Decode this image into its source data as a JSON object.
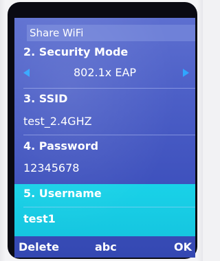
{
  "header": {
    "title": "Share WiFi"
  },
  "fields": [
    {
      "label": "2. Security Mode",
      "value": "802.1x EAP"
    },
    {
      "label": "3. SSID",
      "value": "test_2.4GHZ"
    },
    {
      "label": "4. Password",
      "value": "12345678"
    },
    {
      "label": "5. Username",
      "value": "test1"
    }
  ],
  "softkeys": {
    "left": "Delete",
    "center": "abc",
    "right": "OK"
  },
  "colors": {
    "background": "#4b5ec6",
    "highlight": "#16c6e0",
    "arrow": "#2fa6ff",
    "text": "#ffffff"
  },
  "icons": {
    "left": "arrow-left-icon",
    "right": "arrow-right-icon"
  }
}
